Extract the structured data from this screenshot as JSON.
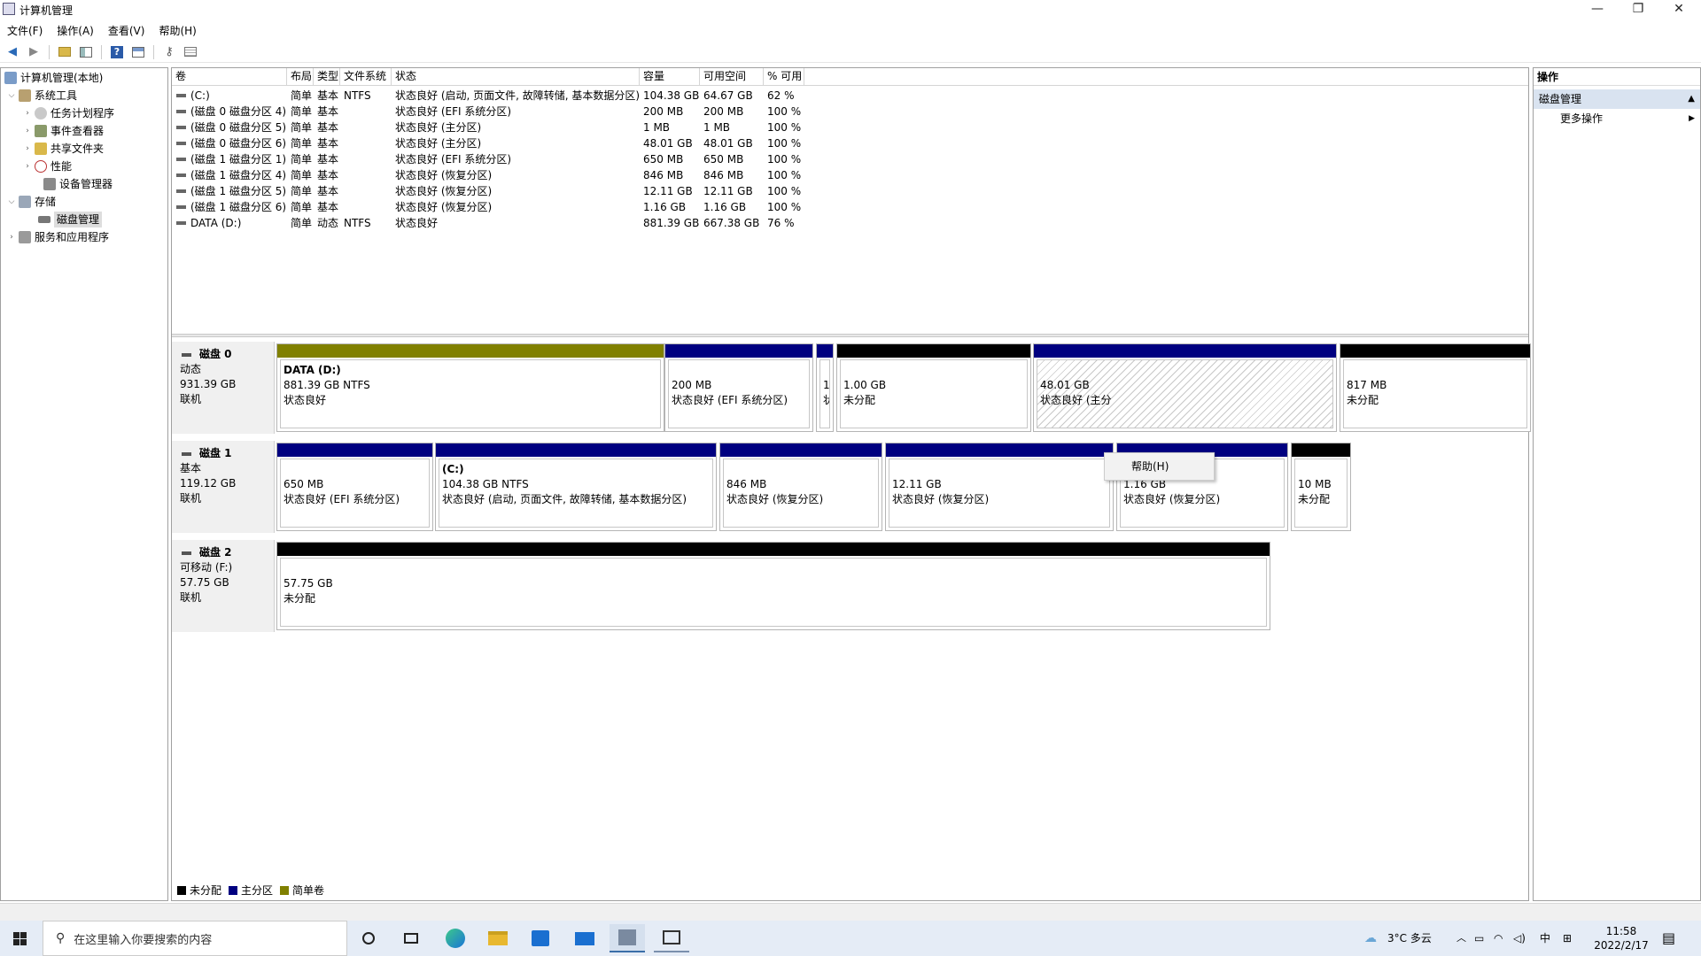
{
  "window": {
    "title": "计算机管理",
    "min": "—",
    "max": "❐",
    "close": "✕"
  },
  "menu": [
    "文件(F)",
    "操作(A)",
    "查看(V)",
    "帮助(H)"
  ],
  "tree": {
    "root": "计算机管理(本地)",
    "system_tools": "系统工具",
    "task_scheduler": "任务计划程序",
    "event_viewer": "事件查看器",
    "shared_folders": "共享文件夹",
    "performance": "性能",
    "device_manager": "设备管理器",
    "storage": "存储",
    "disk_management": "磁盘管理",
    "services_apps": "服务和应用程序"
  },
  "volume_list": {
    "headers": [
      "卷",
      "布局",
      "类型",
      "文件系统",
      "状态",
      "容量",
      "可用空间",
      "% 可用"
    ],
    "rows": [
      [
        "(C:)",
        "简单",
        "基本",
        "NTFS",
        "状态良好 (启动, 页面文件, 故障转储, 基本数据分区)",
        "104.38 GB",
        "64.67 GB",
        "62 %"
      ],
      [
        "(磁盘 0 磁盘分区 4)",
        "简单",
        "基本",
        "",
        "状态良好 (EFI 系统分区)",
        "200 MB",
        "200 MB",
        "100 %"
      ],
      [
        "(磁盘 0 磁盘分区 5)",
        "简单",
        "基本",
        "",
        "状态良好 (主分区)",
        "1 MB",
        "1 MB",
        "100 %"
      ],
      [
        "(磁盘 0 磁盘分区 6)",
        "简单",
        "基本",
        "",
        "状态良好 (主分区)",
        "48.01 GB",
        "48.01 GB",
        "100 %"
      ],
      [
        "(磁盘 1 磁盘分区 1)",
        "简单",
        "基本",
        "",
        "状态良好 (EFI 系统分区)",
        "650 MB",
        "650 MB",
        "100 %"
      ],
      [
        "(磁盘 1 磁盘分区 4)",
        "简单",
        "基本",
        "",
        "状态良好 (恢复分区)",
        "846 MB",
        "846 MB",
        "100 %"
      ],
      [
        "(磁盘 1 磁盘分区 5)",
        "简单",
        "基本",
        "",
        "状态良好 (恢复分区)",
        "12.11 GB",
        "12.11 GB",
        "100 %"
      ],
      [
        "(磁盘 1 磁盘分区 6)",
        "简单",
        "基本",
        "",
        "状态良好 (恢复分区)",
        "1.16 GB",
        "1.16 GB",
        "100 %"
      ],
      [
        "DATA (D:)",
        "简单",
        "动态",
        "NTFS",
        "状态良好",
        "881.39 GB",
        "667.38 GB",
        "76 %"
      ]
    ]
  },
  "disks": [
    {
      "name": "磁盘 0",
      "type": "动态",
      "size": "931.39 GB",
      "status": "联机",
      "parts": [
        {
          "title": "DATA  (D:)",
          "line1": "881.39 GB NTFS",
          "line2": "状态良好",
          "bar": "#808000"
        },
        {
          "title": "",
          "line1": "200 MB",
          "line2": "状态良好 (EFI 系统分区)",
          "bar": "#000080"
        },
        {
          "title": "",
          "line1": "1",
          "line2": "状",
          "bar": "#000080"
        },
        {
          "title": "",
          "line1": "1.00 GB",
          "line2": "未分配",
          "bar": "#000000"
        },
        {
          "title": "",
          "line1": "48.01 GB",
          "line2": "状态良好 (主分",
          "bar": "#000080"
        },
        {
          "title": "",
          "line1": "817 MB",
          "line2": "未分配",
          "bar": "#000000"
        }
      ]
    },
    {
      "name": "磁盘 1",
      "type": "基本",
      "size": "119.12 GB",
      "status": "联机",
      "parts": [
        {
          "title": "",
          "line1": "650 MB",
          "line2": "状态良好 (EFI 系统分区)",
          "bar": "#000080"
        },
        {
          "title": "(C:)",
          "line1": "104.38 GB NTFS",
          "line2": "状态良好 (启动, 页面文件, 故障转储, 基本数据分区)",
          "bar": "#000080"
        },
        {
          "title": "",
          "line1": "846 MB",
          "line2": "状态良好 (恢复分区)",
          "bar": "#000080"
        },
        {
          "title": "",
          "line1": "12.11 GB",
          "line2": "状态良好 (恢复分区)",
          "bar": "#000080"
        },
        {
          "title": "",
          "line1": "1.16 GB",
          "line2": "状态良好 (恢复分区)",
          "bar": "#000080"
        },
        {
          "title": "",
          "line1": "10 MB",
          "line2": "未分配",
          "bar": "#000000"
        }
      ]
    },
    {
      "name": "磁盘 2",
      "type": "可移动 (F:)",
      "size": "57.75 GB",
      "status": "联机",
      "parts": [
        {
          "title": "",
          "line1": "57.75 GB",
          "line2": "未分配",
          "bar": "#000000"
        }
      ]
    }
  ],
  "context_menu": {
    "help": "帮助(H)"
  },
  "legend": {
    "unallocated": "未分配",
    "primary": "主分区",
    "simple": "简单卷",
    "colors": {
      "unallocated": "#000000",
      "primary": "#000080",
      "simple": "#808000"
    }
  },
  "actions": {
    "header": "操作",
    "section": "磁盘管理",
    "more": "更多操作"
  },
  "taskbar": {
    "search_placeholder": "在这里输入你要搜索的内容",
    "weather": "3°C 多云",
    "ime": "中",
    "time": "11:58",
    "date": "2022/2/17"
  }
}
